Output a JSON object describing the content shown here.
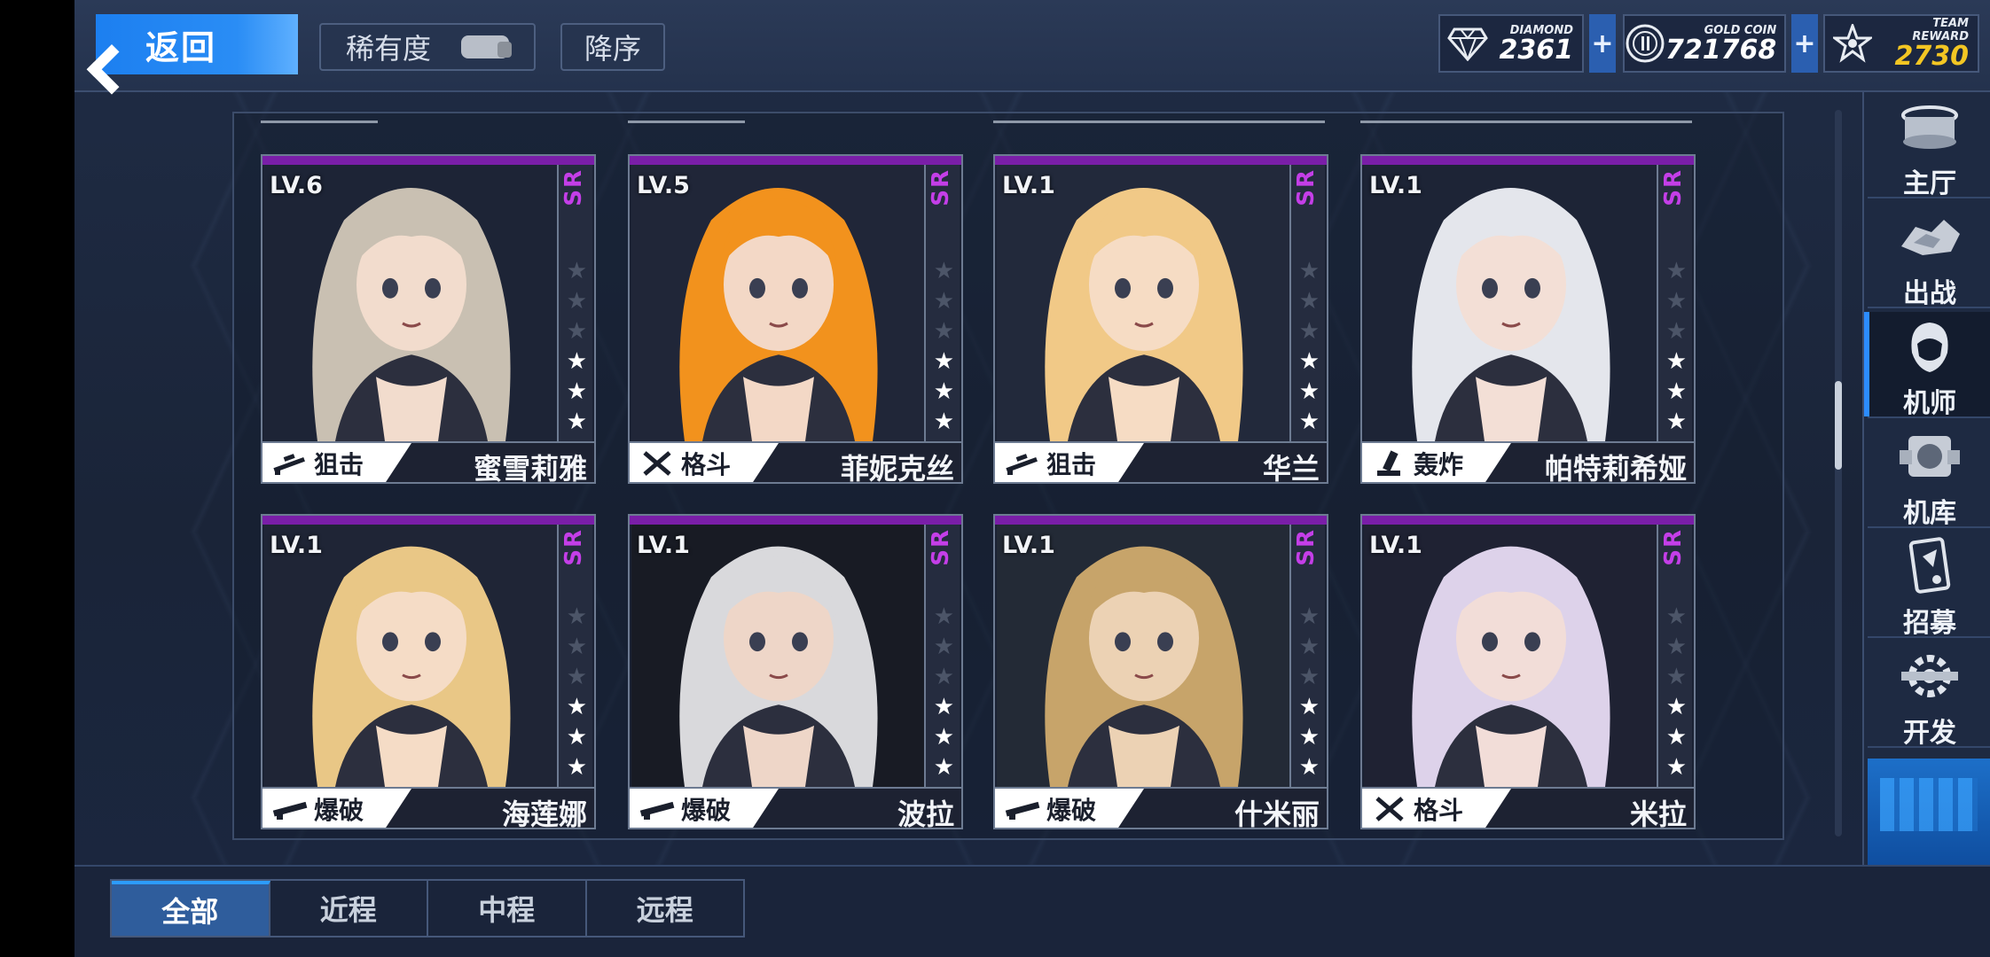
{
  "topbar": {
    "back_label": "返回",
    "rarity_label": "稀有度",
    "sort_label": "降序"
  },
  "resources": [
    {
      "name": "DIAMOND",
      "value": "2361",
      "icon": "diamond-icon",
      "color": "#ffffff"
    },
    {
      "name": "GOLD COIN",
      "value": "721768",
      "icon": "gold-coin-icon",
      "color": "#ffffff"
    },
    {
      "name": "TEAM REWARD",
      "value": "2730",
      "icon": "star-badge-icon",
      "color": "#f3c623"
    }
  ],
  "plus_symbol": "+",
  "cards": [
    {
      "level": "LV.6",
      "rarity": "SR",
      "type": "狙击",
      "type_icon": "sniper-rifle-icon",
      "name": "蜜雪莉雅",
      "stars": 3,
      "hair": "#c9c0b2",
      "skin": "#f2dccd",
      "bg": "#1d2436"
    },
    {
      "level": "LV.5",
      "rarity": "SR",
      "type": "格斗",
      "type_icon": "crossed-swords-icon",
      "name": "菲妮克丝",
      "stars": 3,
      "hair": "#f2921d",
      "skin": "#f3d8c6",
      "bg": "#202638"
    },
    {
      "level": "LV.1",
      "rarity": "SR",
      "type": "狙击",
      "type_icon": "sniper-rifle-icon",
      "name": "华兰",
      "stars": 3,
      "hair": "#f1c987",
      "skin": "#f6dcc4",
      "bg": "#22293b"
    },
    {
      "level": "LV.1",
      "rarity": "SR",
      "type": "轰炸",
      "type_icon": "mortar-icon",
      "name": "帕特莉希娅",
      "stars": 3,
      "hair": "#e4e6ec",
      "skin": "#f3dfd6",
      "bg": "#1d2436"
    },
    {
      "level": "LV.1",
      "rarity": "SR",
      "type": "爆破",
      "type_icon": "rifle-icon",
      "name": "海莲娜",
      "stars": 3,
      "hair": "#e9c786",
      "skin": "#f5dcc6",
      "bg": "#1f2536"
    },
    {
      "level": "LV.1",
      "rarity": "SR",
      "type": "爆破",
      "type_icon": "rifle-icon",
      "name": "波拉",
      "stars": 3,
      "hair": "#d9d9dc",
      "skin": "#eed6c8",
      "bg": "#181b24"
    },
    {
      "level": "LV.1",
      "rarity": "SR",
      "type": "爆破",
      "type_icon": "rifle-icon",
      "name": "什米丽",
      "stars": 3,
      "hair": "#c7a46a",
      "skin": "#ecd2b4",
      "bg": "#232a36"
    },
    {
      "level": "LV.1",
      "rarity": "SR",
      "type": "格斗",
      "type_icon": "crossed-swords-icon",
      "name": "米拉",
      "stars": 3,
      "hair": "#ddd2ea",
      "skin": "#f2ddd8",
      "bg": "#1f2233"
    }
  ],
  "sidenav": [
    {
      "label": "主厅",
      "icon": "hall-icon"
    },
    {
      "label": "出战",
      "icon": "sortie-icon"
    },
    {
      "label": "机师",
      "icon": "pilot-icon",
      "active": true
    },
    {
      "label": "机库",
      "icon": "hangar-icon"
    },
    {
      "label": "招募",
      "icon": "recruit-card-icon"
    },
    {
      "label": "开发",
      "icon": "develop-gear-icon"
    }
  ],
  "tabs": [
    {
      "label": "全部",
      "active": true
    },
    {
      "label": "近程"
    },
    {
      "label": "中程"
    },
    {
      "label": "远程"
    }
  ]
}
